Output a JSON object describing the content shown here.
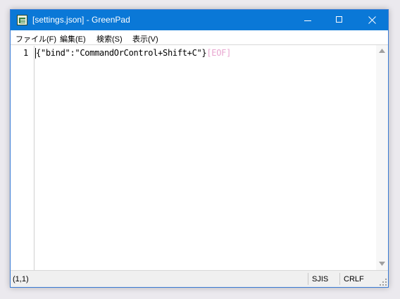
{
  "window": {
    "title": "[settings.json] - GreenPad",
    "app_icon": "greenpad-app-icon",
    "caption_buttons": [
      "minimize-icon",
      "maximize-icon",
      "close-icon"
    ],
    "accent_color": "#0a78d7"
  },
  "menu": {
    "file": "ファイル(F)",
    "edit": "編集(E)",
    "search": "検索(S)",
    "view": "表示(V)"
  },
  "editor": {
    "lines": [
      {
        "number": "1",
        "text": "{\"bind\":\"CommandOrControl+Shift+C\"}",
        "eof_marker": "[EOF]"
      }
    ],
    "eof_color": "#e8a5cf"
  },
  "statusbar": {
    "position": "(1,1)",
    "encoding": "SJIS",
    "line_ending": "CRLF"
  }
}
